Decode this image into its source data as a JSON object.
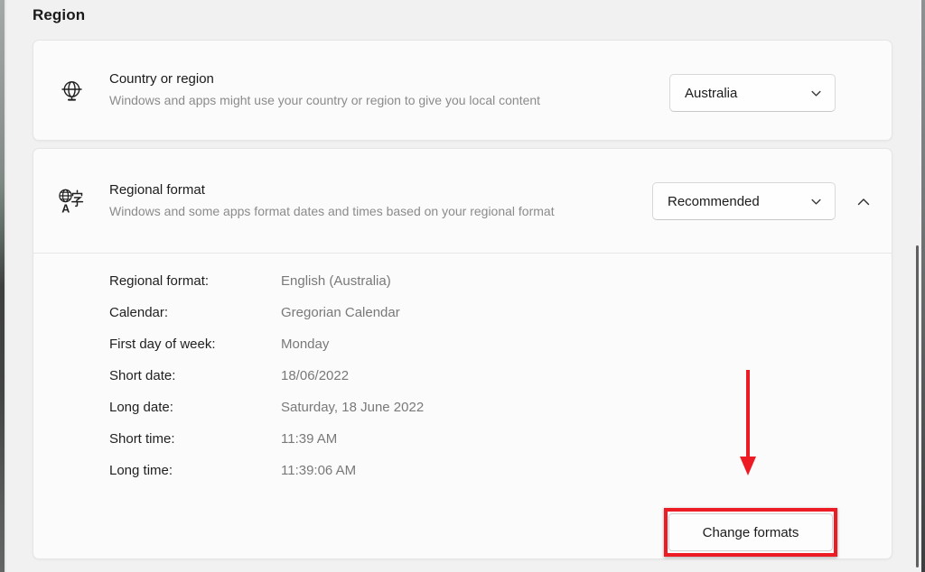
{
  "page": {
    "heading": "Region"
  },
  "colors": {
    "annotation_red": "#ed1c24",
    "card_background": "#fbfbfb",
    "page_background": "#f1f1f1",
    "primary_text": "#1b1b1b",
    "secondary_text": "#8b8b8b"
  },
  "country_card": {
    "icon": "globe-icon",
    "title": "Country or region",
    "description": "Windows and apps might use your country or region to give you local content",
    "dropdown_value": "Australia"
  },
  "regional_card": {
    "icon": "language-globe-icon",
    "title": "Regional format",
    "description": "Windows and some apps format dates and times based on your regional format",
    "dropdown_value": "Recommended",
    "expander_state": "expanded",
    "details": [
      {
        "label": "Regional format:",
        "value": "English (Australia)"
      },
      {
        "label": "Calendar:",
        "value": "Gregorian Calendar"
      },
      {
        "label": "First day of week:",
        "value": "Monday"
      },
      {
        "label": "Short date:",
        "value": "18/06/2022"
      },
      {
        "label": "Long date:",
        "value": "Saturday, 18 June 2022"
      },
      {
        "label": "Short time:",
        "value": "11:39 AM"
      },
      {
        "label": "Long time:",
        "value": "11:39:06 AM"
      }
    ],
    "change_button_label": "Change formats"
  }
}
